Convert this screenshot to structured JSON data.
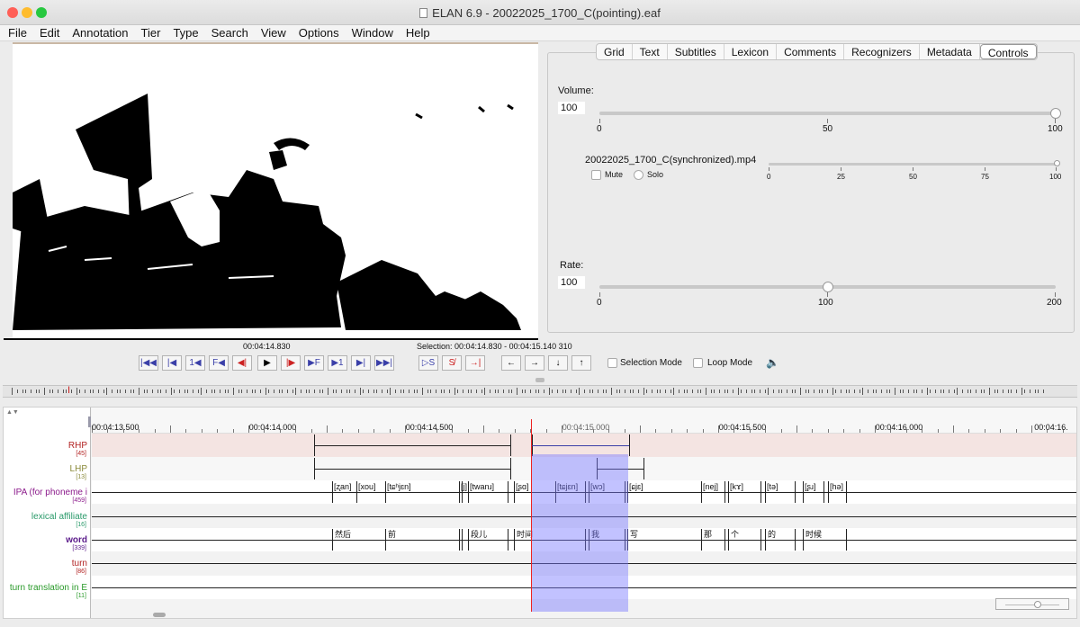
{
  "window": {
    "title": "ELAN 6.9 - 20022025_1700_C(pointing).eaf"
  },
  "colors": {
    "close": "#ff5f57",
    "minimize": "#febc2e",
    "zoom": "#28c840",
    "selection": "#7878ff",
    "cursor": "#ee2222",
    "rhp": "#b22222",
    "lhp": "#8a8a3a",
    "ipa": "#8b1a8b",
    "lexical": "#2a9a6a",
    "word": "#5a1a8a",
    "turn": "#b22222",
    "turn_translation": "#2a9a2a"
  },
  "menu": [
    "File",
    "Edit",
    "Annotation",
    "Tier",
    "Type",
    "Search",
    "View",
    "Options",
    "Window",
    "Help"
  ],
  "tabs": [
    "Grid",
    "Text",
    "Subtitles",
    "Lexicon",
    "Comments",
    "Recognizers",
    "Metadata",
    "Controls"
  ],
  "active_tab": "Controls",
  "controls": {
    "volume_label": "Volume:",
    "volume_value": "100",
    "volume_level": 100,
    "volume_ticks": [
      "0",
      "50",
      "100"
    ],
    "media_file": "20022025_1700_C(synchronized).mp4",
    "media_level": 100,
    "mute_label": "Mute",
    "solo_label": "Solo",
    "media_ticks": [
      "0",
      "25",
      "50",
      "75",
      "100"
    ],
    "rate_label": "Rate:",
    "rate_value": "100",
    "rate_level": 100,
    "rate_ticks": [
      "0",
      "100",
      "200"
    ]
  },
  "player": {
    "current_time": "00:04:14.830",
    "selection_text": "Selection: 00:04:14.830 - 00:04:15.140  310",
    "selection_mode_label": "Selection Mode",
    "loop_mode_label": "Loop Mode",
    "buttons": [
      "|◀◀",
      "|◀",
      "1◀",
      "F◀",
      "◀|",
      "▶",
      "|▶",
      "▶F",
      "▶1",
      "▶|",
      "▶▶|"
    ],
    "sel_buttons": [
      "▷S",
      "S̸",
      "→|"
    ],
    "nav_buttons": [
      "←",
      "→",
      "↓",
      "↑"
    ]
  },
  "ruler": {
    "times": [
      "00:04:13.500",
      "00:04:14.000",
      "00:04:14.500",
      "00:04:15.000",
      "00:04:15.500",
      "00:04:16.000",
      "00:04:16."
    ]
  },
  "tiers": [
    {
      "name": "RHP",
      "count": "[45]"
    },
    {
      "name": "LHP",
      "count": "[13]"
    },
    {
      "name": "IPA (for phoneme i",
      "count": "[459]"
    },
    {
      "name": "lexical affiliate",
      "count": "[16]"
    },
    {
      "name": "word",
      "count": "[339]"
    },
    {
      "name": "turn",
      "count": "[86]"
    },
    {
      "name": "turn translation in E",
      "count": "[11]"
    }
  ],
  "ipa_annotations": [
    "[ʐan]",
    "[xou]",
    "[tɕʰjɛn]",
    "[j]",
    "[twanɹ]",
    "[ʂɑ]",
    "[tɕjɛn]",
    "[wɔ]",
    "[ɕjɛ]",
    "[nej]",
    "[kɤ]",
    "[tə]",
    "[ʂɹ]",
    "[hə]"
  ],
  "word_annotations": [
    "然后",
    "前",
    "段儿",
    "时间",
    "我",
    "写",
    "那",
    "个",
    "的",
    "时候"
  ]
}
